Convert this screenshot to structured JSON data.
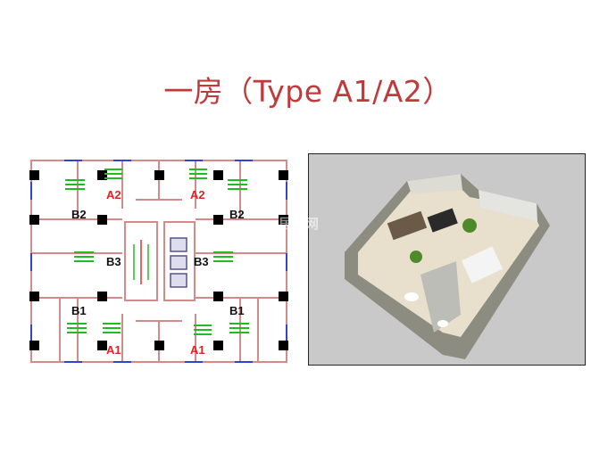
{
  "title": "一房（Type A1/A2）",
  "floor_plan": {
    "units": [
      {
        "label": "A2",
        "color": "#e02424"
      },
      {
        "label": "A2",
        "color": "#e02424"
      },
      {
        "label": "B2",
        "color": "#111111"
      },
      {
        "label": "B2",
        "color": "#111111"
      },
      {
        "label": "B3",
        "color": "#111111"
      },
      {
        "label": "B3",
        "color": "#111111"
      },
      {
        "label": "B1",
        "color": "#111111"
      },
      {
        "label": "B1",
        "color": "#111111"
      },
      {
        "label": "A1",
        "color": "#e02424"
      },
      {
        "label": "A1",
        "color": "#e02424"
      }
    ]
  },
  "watermark": "居房网"
}
